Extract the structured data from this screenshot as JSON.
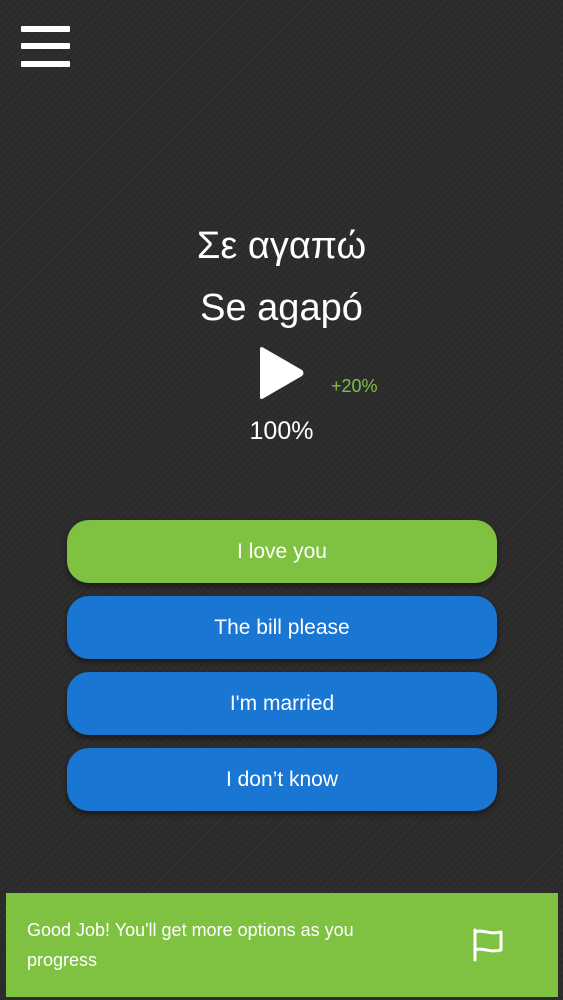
{
  "header": {
    "menu_icon": "hamburger-menu-icon"
  },
  "question": {
    "native": "Σε αγαπώ",
    "transliteration": "Se agapó",
    "play_icon": "play-icon",
    "xp_gain": "+20%",
    "progress": "100%"
  },
  "answers": [
    {
      "label": "I love you",
      "state": "correct"
    },
    {
      "label": "The bill please",
      "state": "option"
    },
    {
      "label": "I'm married",
      "state": "option"
    },
    {
      "label": "I don’t know",
      "state": "option"
    }
  ],
  "feedback": {
    "message": "Good Job! You'll get more options as you progress",
    "flag_icon": "flag-icon"
  },
  "colors": {
    "background": "#2b2b2b",
    "correct": "#7fc241",
    "option": "#1976d2",
    "xp": "#7cc242"
  }
}
